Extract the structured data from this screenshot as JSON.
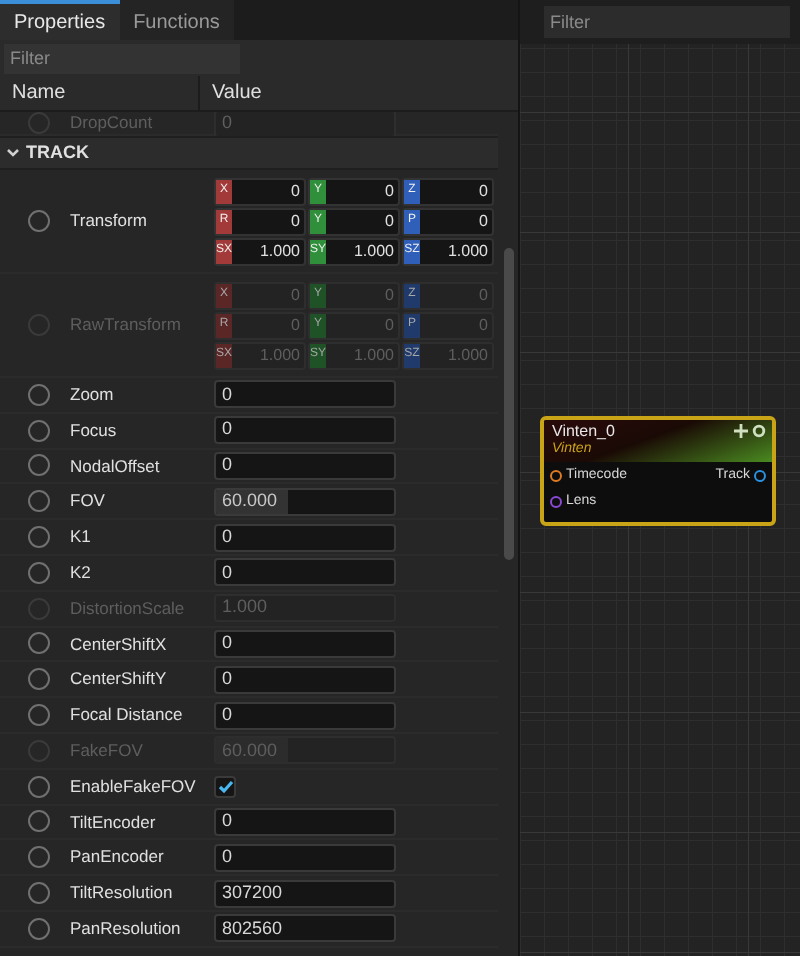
{
  "tabs": [
    {
      "label": "Properties",
      "selected": true
    },
    {
      "label": "Functions",
      "selected": false
    }
  ],
  "filter": {
    "placeholder": "Filter"
  },
  "columns": [
    "Name",
    "Value"
  ],
  "rows": [
    {
      "kind": "number",
      "name": "DropCount",
      "value": "0",
      "disabled": true,
      "selected": false
    },
    {
      "kind": "section",
      "name": "TRACK",
      "expanded": true
    },
    {
      "kind": "vector",
      "name": "Transform",
      "disabled": false,
      "selected": false,
      "lines": [
        [
          {
            "label": "X",
            "value": "0",
            "color": "#a33a3a"
          },
          {
            "label": "Y",
            "value": "0",
            "color": "#2f8f3a"
          },
          {
            "label": "Z",
            "value": "0",
            "color": "#2f5fb8"
          }
        ],
        [
          {
            "label": "R",
            "value": "0",
            "color": "#a33a3a"
          },
          {
            "label": "Y",
            "value": "0",
            "color": "#2f8f3a"
          },
          {
            "label": "P",
            "value": "0",
            "color": "#2f5fb8"
          }
        ],
        [
          {
            "label": "SX",
            "value": "1.000",
            "color": "#a33a3a"
          },
          {
            "label": "SY",
            "value": "1.000",
            "color": "#2f8f3a"
          },
          {
            "label": "SZ",
            "value": "1.000",
            "color": "#2f5fb8"
          }
        ]
      ]
    },
    {
      "kind": "vector",
      "name": "RawTransform",
      "disabled": true,
      "selected": false,
      "lines": [
        [
          {
            "label": "X",
            "value": "0",
            "color": "#5a2626"
          },
          {
            "label": "Y",
            "value": "0",
            "color": "#1f5226"
          },
          {
            "label": "Z",
            "value": "0",
            "color": "#1f3a6b"
          }
        ],
        [
          {
            "label": "R",
            "value": "0",
            "color": "#5a2626"
          },
          {
            "label": "Y",
            "value": "0",
            "color": "#1f5226"
          },
          {
            "label": "P",
            "value": "0",
            "color": "#1f3a6b"
          }
        ],
        [
          {
            "label": "SX",
            "value": "1.000",
            "color": "#5a2626"
          },
          {
            "label": "SY",
            "value": "1.000",
            "color": "#1f5226"
          },
          {
            "label": "SZ",
            "value": "1.000",
            "color": "#1f3a6b"
          }
        ]
      ]
    },
    {
      "kind": "number",
      "name": "Zoom",
      "value": "0",
      "disabled": false,
      "selected": false
    },
    {
      "kind": "number",
      "name": "Focus",
      "value": "0",
      "disabled": false,
      "selected": false
    },
    {
      "kind": "number",
      "name": "NodalOffset",
      "value": "0",
      "disabled": false,
      "selected": false
    },
    {
      "kind": "slider",
      "name": "FOV",
      "value": "60.000",
      "level": 0.4,
      "disabled": false,
      "selected": false
    },
    {
      "kind": "number",
      "name": "K1",
      "value": "0",
      "disabled": false,
      "selected": false
    },
    {
      "kind": "number",
      "name": "K2",
      "value": "0",
      "disabled": false,
      "selected": false
    },
    {
      "kind": "number",
      "name": "DistortionScale",
      "value": "1.000",
      "disabled": true,
      "selected": false
    },
    {
      "kind": "number",
      "name": "CenterShiftX",
      "value": "0",
      "disabled": false,
      "selected": false
    },
    {
      "kind": "number",
      "name": "CenterShiftY",
      "value": "0",
      "disabled": false,
      "selected": false
    },
    {
      "kind": "number",
      "name": "Focal Distance",
      "value": "0",
      "disabled": false,
      "selected": false
    },
    {
      "kind": "slider",
      "name": "FakeFOV",
      "value": "60.000",
      "level": 0.4,
      "disabled": true,
      "selected": false
    },
    {
      "kind": "checkbox",
      "name": "EnableFakeFOV",
      "checked": true,
      "disabled": false,
      "selected": false
    },
    {
      "kind": "number",
      "name": "TiltEncoder",
      "value": "0",
      "disabled": false,
      "selected": false
    },
    {
      "kind": "number",
      "name": "PanEncoder",
      "value": "0",
      "disabled": false,
      "selected": false
    },
    {
      "kind": "number",
      "name": "TiltResolution",
      "value": "307200",
      "disabled": false,
      "selected": false
    },
    {
      "kind": "number",
      "name": "PanResolution",
      "value": "802560",
      "disabled": false,
      "selected": false
    }
  ],
  "graph": {
    "filter": {
      "placeholder": "Filter"
    },
    "node": {
      "title": "Vinten_0",
      "subtitle": "Vinten",
      "inputs": [
        {
          "label": "Timecode",
          "color": "#e07a20"
        },
        {
          "label": "Lens",
          "color": "#8a4ad8"
        }
      ],
      "outputs": [
        {
          "label": "Track",
          "color": "#2a90e0"
        }
      ]
    }
  }
}
